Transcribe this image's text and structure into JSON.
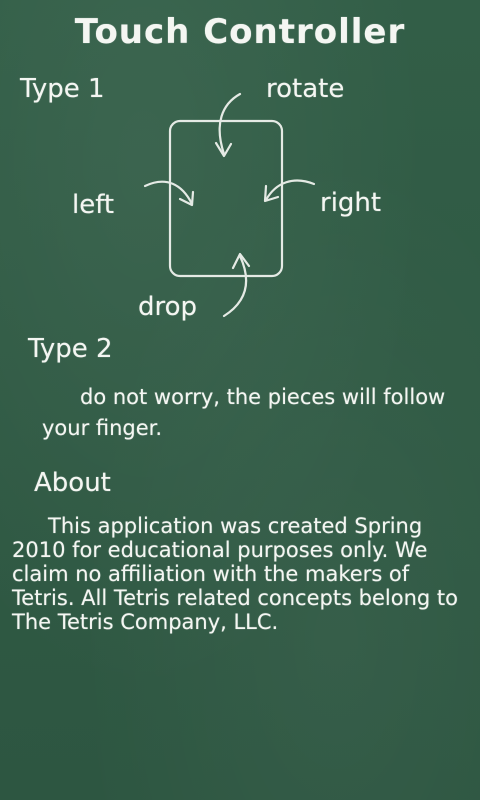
{
  "screen": {
    "title": "Touch Controller",
    "background_color": "#2f5a44",
    "chalk_color": "#f4f6f2"
  },
  "type1": {
    "heading": "Type 1",
    "labels": {
      "rotate": "rotate",
      "left": "left",
      "right": "right",
      "drop": "drop"
    }
  },
  "type2": {
    "heading": "Type 2",
    "description": "do not worry, the pieces will follow your finger."
  },
  "about": {
    "heading": "About",
    "text": "This application was created Spring 2010 for educational purposes only. We claim no affiliation with the makers of Tetris. All Tetris related concepts belong to The Tetris Company, LLC."
  }
}
